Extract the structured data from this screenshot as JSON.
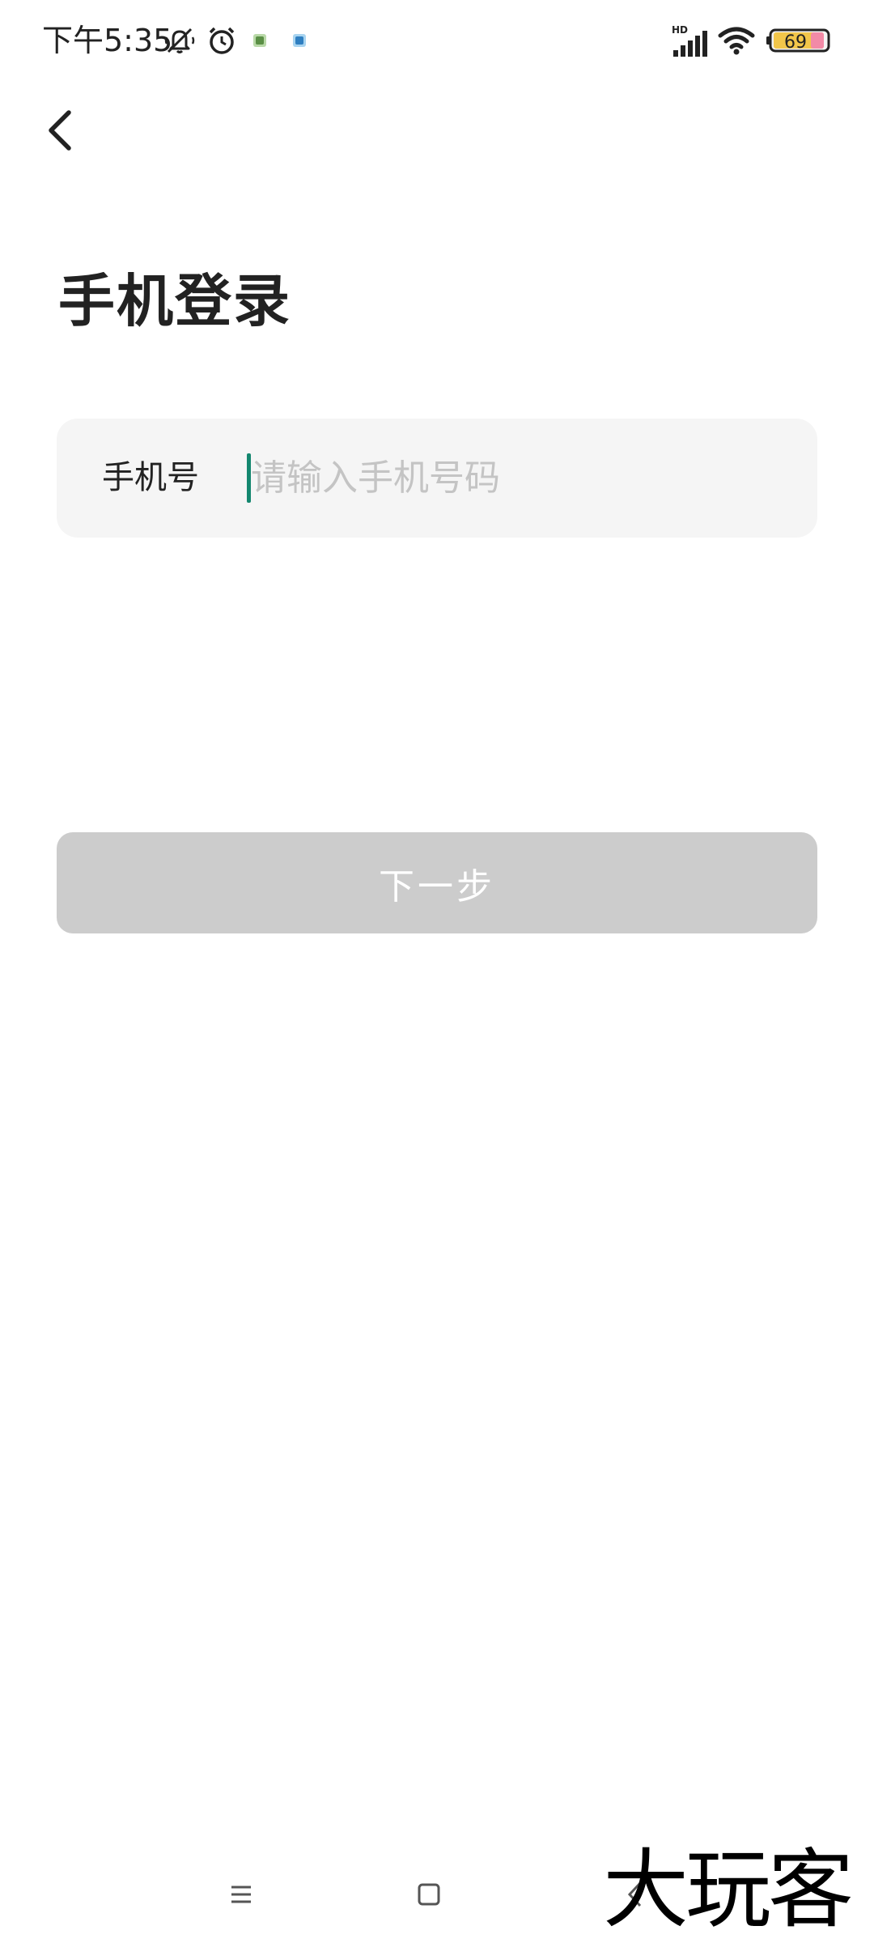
{
  "status_bar": {
    "time": "下午5:35",
    "network_label": "HD",
    "battery_level": "69",
    "icons": [
      "bell-muted-icon",
      "alarm-icon",
      "app-notification-icon",
      "app-notification-icon",
      "signal-icon",
      "wifi-icon",
      "battery-icon"
    ]
  },
  "header": {
    "back_icon": "chevron-left-icon"
  },
  "main": {
    "title": "手机登录",
    "phone_label": "手机号",
    "phone_placeholder": "请输入手机号码",
    "phone_value": "",
    "next_label": "下一步",
    "colors": {
      "cursor": "#14876f",
      "button_disabled": "#cccccc",
      "input_bg": "#f5f5f5"
    }
  },
  "nav_bar": {
    "icons": [
      "menu-icon",
      "home-icon",
      "back-icon"
    ]
  },
  "watermark": {
    "text": "大玩客"
  }
}
